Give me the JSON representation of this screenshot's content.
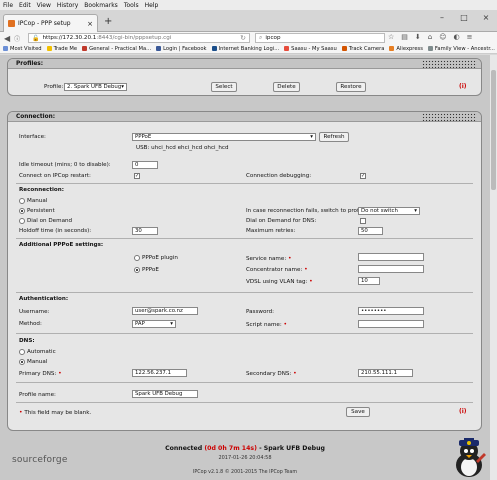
{
  "browser": {
    "menu": [
      "File",
      "Edit",
      "View",
      "History",
      "Bookmarks",
      "Tools",
      "Help"
    ],
    "tab_title": "IPCop - PPP setup",
    "url_host": "https://172.30.20.1",
    "url_rest": ":8443/cgi-bin/pppsetup.cgi",
    "search_value": "ipcop",
    "bookmarks": [
      {
        "label": "Most Visited",
        "color": "#6b8fd6"
      },
      {
        "label": "Trade Me",
        "color": "#f2c000"
      },
      {
        "label": "General - Practical Ma...",
        "color": "#c0392b"
      },
      {
        "label": "Login | Facebook",
        "color": "#3b5998"
      },
      {
        "label": "Internet Banking Logi...",
        "color": "#1a4e8a"
      },
      {
        "label": "Saasu - My Saasu",
        "color": "#e74c3c"
      },
      {
        "label": "Track Camera",
        "color": "#d35400"
      },
      {
        "label": "Aliexpress",
        "color": "#e67e22"
      },
      {
        "label": "Family View - Ancestr...",
        "color": "#7f8c8d"
      }
    ]
  },
  "profiles": {
    "heading": "Profiles:",
    "profile_label": "Profile:",
    "profile_value": "2. Spark UFB Debug",
    "select_label": "Select",
    "delete_label": "Delete",
    "restore_label": "Restore"
  },
  "connection": {
    "heading": "Connection:",
    "interface_label": "Interface:",
    "interface_value": "PPPoE",
    "refresh_label": "Refresh",
    "usb_text": "USB:  uhci_hcd ehci_hcd ohci_hcd",
    "idle_label": "Idle timeout (mins; 0 to disable):",
    "idle_value": "0",
    "connect_restart_label": "Connect on IPCop restart:",
    "connect_restart_checked": true,
    "debug_label": "Connection debugging:",
    "debug_checked": true,
    "reconnection_heading": "Reconnection:",
    "manual_label": "Manual",
    "persistent_label": "Persistent",
    "dial_demand_label": "Dial on Demand",
    "holdoff_label": "Holdoff time (in seconds):",
    "holdoff_value": "30",
    "switch_profile_label": "In case reconnection fails, switch to profile:",
    "switch_profile_value": "Do not switch",
    "dial_dns_label": "Dial on Demand for DNS:",
    "max_retries_label": "Maximum retries:",
    "max_retries_value": "50",
    "pppoe_heading": "Additional PPPoE settings:",
    "pppoe_plugin_label": "PPPoE plugin",
    "pppoe_label": "PPPoE",
    "service_label": "Service name:",
    "concentrator_label": "Concentrator name:",
    "vdsl_label": "VDSL using VLAN tag:",
    "vdsl_value": "10",
    "auth_heading": "Authentication:",
    "username_label": "Username:",
    "username_value": "user@spark.co.nz",
    "password_label": "Password:",
    "password_value": "••••••••",
    "method_label": "Method:",
    "method_value": "PAP",
    "script_label": "Script name:",
    "dns_heading": "DNS:",
    "automatic_label": "Automatic",
    "manual_dns_label": "Manual",
    "primary_dns_label": "Primary DNS:",
    "primary_dns_value": "122.56.237.1",
    "secondary_dns_label": "Secondary DNS:",
    "secondary_dns_value": "210.55.111.1",
    "profile_name_label": "Profile name:",
    "profile_name_value": "Spark UFB Debug",
    "blank_note": "This field may be blank.",
    "save_label": "Save"
  },
  "footer": {
    "status_prefix": "Connected",
    "status_time": "(0d 0h 7m 14s)",
    "status_suffix": "- Spark UFB Debug",
    "date": "2017-01-26 20:04:58",
    "copyright": "IPCop v2.1.8 © 2001-2015 The IPCop Team",
    "sourceforge": "sourceforge"
  }
}
